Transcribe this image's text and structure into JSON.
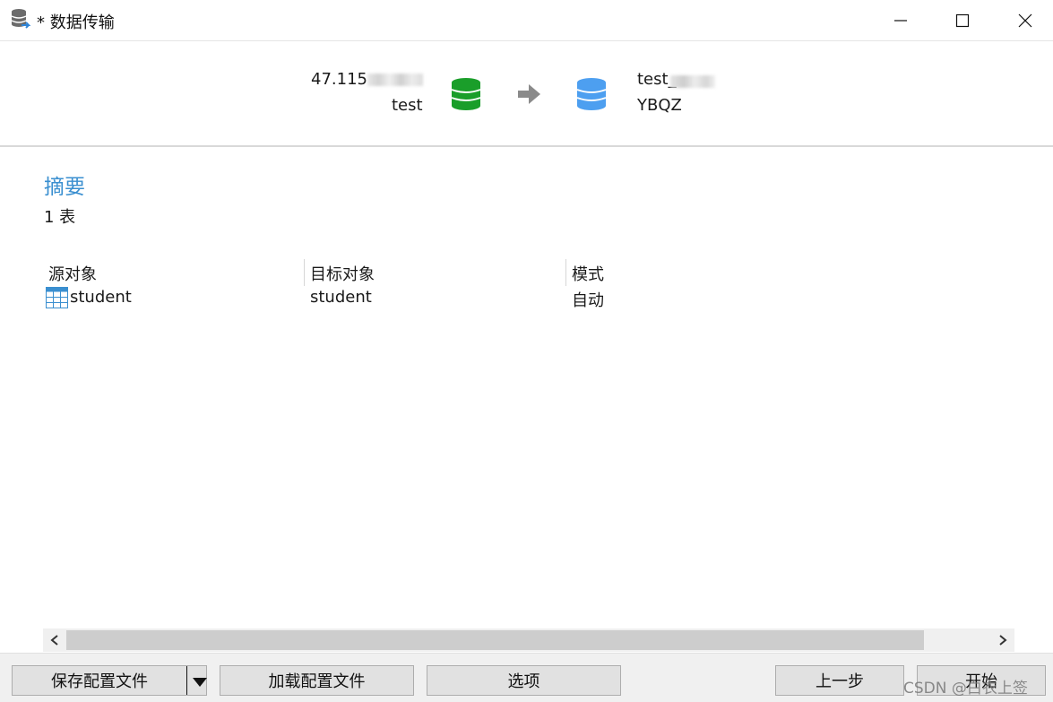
{
  "window": {
    "title": "* 数据传输",
    "icon": "database-transfer-icon"
  },
  "header": {
    "source": {
      "host": "47.115",
      "database": "test"
    },
    "target": {
      "host": "test_",
      "database": "YBQZ"
    },
    "source_color": "#1a9e2a",
    "target_color": "#4d9ff0"
  },
  "summary": {
    "title": "摘要",
    "count": "1 表"
  },
  "table": {
    "columns": [
      "源对象",
      "目标对象",
      "模式"
    ],
    "rows": [
      {
        "source": "student",
        "target": "student",
        "mode": "自动"
      }
    ]
  },
  "footer": {
    "save_label": "保存配置文件",
    "load_label": "加载配置文件",
    "options_label": "选项",
    "prev_label": "上一步",
    "start_label": "开始",
    "watermark": "CSDN @白衣上签"
  }
}
